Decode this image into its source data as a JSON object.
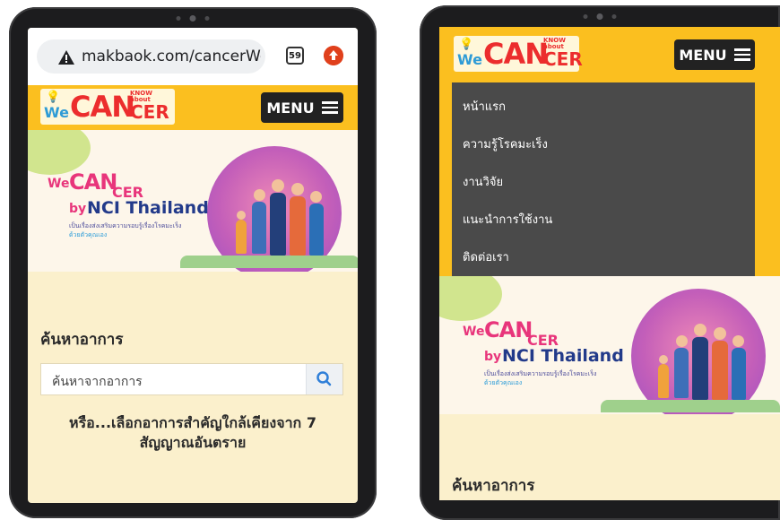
{
  "left_device": {
    "browser": {
      "url": "makbaok.com/cancerWebsit",
      "tab_count": "59"
    },
    "header": {
      "logo": {
        "we": "We",
        "can": "CAN",
        "cer": "CER",
        "know": "KNOW",
        "about": "about"
      },
      "menu_label": "MENU"
    },
    "banner": {
      "we": "We",
      "can": "CAN",
      "cer": "CER",
      "by": "by",
      "nci": "NCI Thailand",
      "tagline1": "เป็นเรื่องส่งเสริมความรอบรู้เรื่องโรคมะเร็ง",
      "tagline2": "ด้วยตัวคุณเอง"
    },
    "search": {
      "title": "ค้นหาอาการ",
      "placeholder": "ค้นหาจากอาการ"
    },
    "or_text_line1": "หรือ...เลือกอาการสำคัญใกล้เคียงจาก 7",
    "or_text_line2": "สัญญาณอันตราย"
  },
  "right_device": {
    "header": {
      "logo": {
        "we": "We",
        "can": "CAN",
        "cer": "CER",
        "know": "KNOW",
        "about": "about"
      },
      "menu_label": "MENU"
    },
    "menu_items": [
      "หน้าแรก",
      "ความรู้โรคมะเร็ง",
      "งานวิจัย",
      "แนะนำการใช้งาน",
      "ติดต่อเรา"
    ],
    "banner": {
      "we": "We",
      "can": "CAN",
      "cer": "CER",
      "by": "by",
      "nci": "NCI Thailand",
      "tagline1": "เป็นเรื่องส่งเสริมความรอบรู้เรื่องโรคมะเร็ง",
      "tagline2": "ด้วยตัวคุณเอง"
    },
    "search": {
      "title": "ค้นหาอาการ"
    }
  },
  "colors": {
    "header_yellow": "#fbbf1f",
    "page_cream": "#fbf0cc",
    "menu_dark": "#4a4a4a",
    "logo_red": "#ec2d2d",
    "brand_blue": "#223a8a",
    "search_icon_blue": "#2f7fd8"
  },
  "icons": [
    "warning-icon",
    "tab-count-icon",
    "upload-icon",
    "hamburger-icon",
    "search-icon",
    "lightbulb-icon"
  ]
}
